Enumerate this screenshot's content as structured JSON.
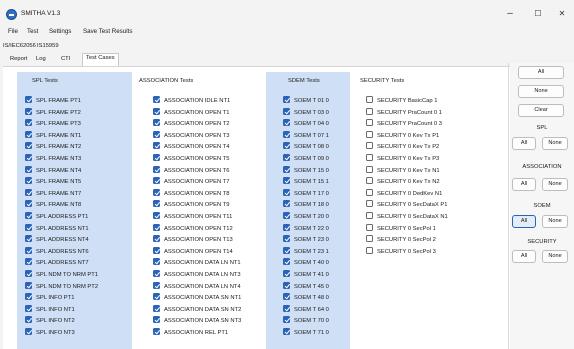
{
  "window": {
    "title": "SMITHA V1.3",
    "minimize": "–",
    "maximize": "☐",
    "close": "✕"
  },
  "menu": [
    "File",
    "Test",
    "Settings",
    "Save Test Results"
  ],
  "standards": [
    "IS/IEC62056",
    "IS15959"
  ],
  "tabs": [
    {
      "label": "Report",
      "active": false
    },
    {
      "label": "Log",
      "active": false
    },
    {
      "label": "CTI",
      "active": false
    },
    {
      "label": "Test Cases",
      "active": true
    }
  ],
  "columns": {
    "spl": {
      "header": "SPL Tests",
      "items": [
        "SPL FRAME PT1",
        "SPL FRAME PT2",
        "SPL FRAME PT3",
        "SPL FRAME NT1",
        "SPL FRAME NT2",
        "SPL FRAME NT3",
        "SPL FRAME NT4",
        "SPL FRAME NT5",
        "SPL FRAME NT7",
        "SPL FRAME NT8",
        "SPL ADDRESS PT1",
        "SPL ADDRESS NT1",
        "SPL ADDRESS NT4",
        "SPL ADDRESS NT6",
        "SPL ADDRESS NT7",
        "SPL NDM TO NRM PT1",
        "SPL NDM TO NRM PT2",
        "SPL INFO PT1",
        "SPL INFO NT1",
        "SPL INFO NT2",
        "SPL INFO NT3"
      ]
    },
    "association": {
      "header": "ASSOCIATION Tests",
      "items": [
        "ASSOCIATION IDLE NT1",
        "ASSOCIATION OPEN T1",
        "ASSOCIATION OPEN T2",
        "ASSOCIATION OPEN T3",
        "ASSOCIATION OPEN T4",
        "ASSOCIATION OPEN T5",
        "ASSOCIATION OPEN T6",
        "ASSOCIATION OPEN T7",
        "ASSOCIATION OPEN T8",
        "ASSOCIATION OPEN T9",
        "ASSOCIATION OPEN T11",
        "ASSOCIATION OPEN T12",
        "ASSOCIATION OPEN T13",
        "ASSOCIATION OPEN T14",
        "ASSOCIATION DATA LN NT1",
        "ASSOCIATION DATA LN NT3",
        "ASSOCIATION DATA LN NT4",
        "ASSOCIATION DATA SN NT1",
        "ASSOCIATION DATA SN NT2",
        "ASSOCIATION DATA SN NT3",
        "ASSOCIATION REL PT1"
      ]
    },
    "sdem": {
      "header": "SDEM Tests",
      "items": [
        "SOEM T 01 0",
        "SOEM T 03 0",
        "SOEM T 04 0",
        "SOEM T 07 1",
        "SOEM T 08 0",
        "SOEM T 09 0",
        "SOEM T 15 0",
        "SOEM T 15 1",
        "SOEM T 17 0",
        "SOEM T 18 0",
        "SOEM T 20 0",
        "SOEM T 22 0",
        "SOEM T 23 0",
        "SOEM T 23 1",
        "SOEM T 40 0",
        "SOEM T 41 0",
        "SOEM T 45 0",
        "SOEM T 48 0",
        "SOEM T 64 0",
        "SOEM T 70 0",
        "SOEM T 71 0"
      ]
    },
    "security": {
      "header": "SECURITY Tests",
      "items": [
        "SECURITY BasicCap 1",
        "SECURITY PraCount 0 1",
        "SECURITY PraCount 0 3",
        "SECURITY 0 Kev Tx P1",
        "SECURITY 0 Kev Tx P2",
        "SECURITY 0 Kev Tx P3",
        "SECURITY 0 Kev Tx N1",
        "SECURITY 0 Kev Tx N2",
        "SECURITY 0 DedKev N1",
        "SECURITY 0 SecDataX P1",
        "SECURITY 0 SecDataX N1",
        "SECURITY 0 SecPol 1",
        "SECURITY 0 SecPol 2",
        "SECURITY 0 SecPol 3"
      ]
    }
  },
  "right_panel": {
    "all": "All",
    "none": "None",
    "clear": "Clear",
    "groups": [
      {
        "label": "SPL",
        "all": "All",
        "none": "None"
      },
      {
        "label": "ASSOCIATION",
        "all": "All",
        "none": "None"
      },
      {
        "label": "SOEM",
        "all": "All",
        "none": "None"
      },
      {
        "label": "SECURITY",
        "all": "All",
        "none": "None"
      }
    ]
  },
  "colors": {
    "checkbox_checked": "#2a63b8",
    "column_highlight": "#cfdff5"
  }
}
